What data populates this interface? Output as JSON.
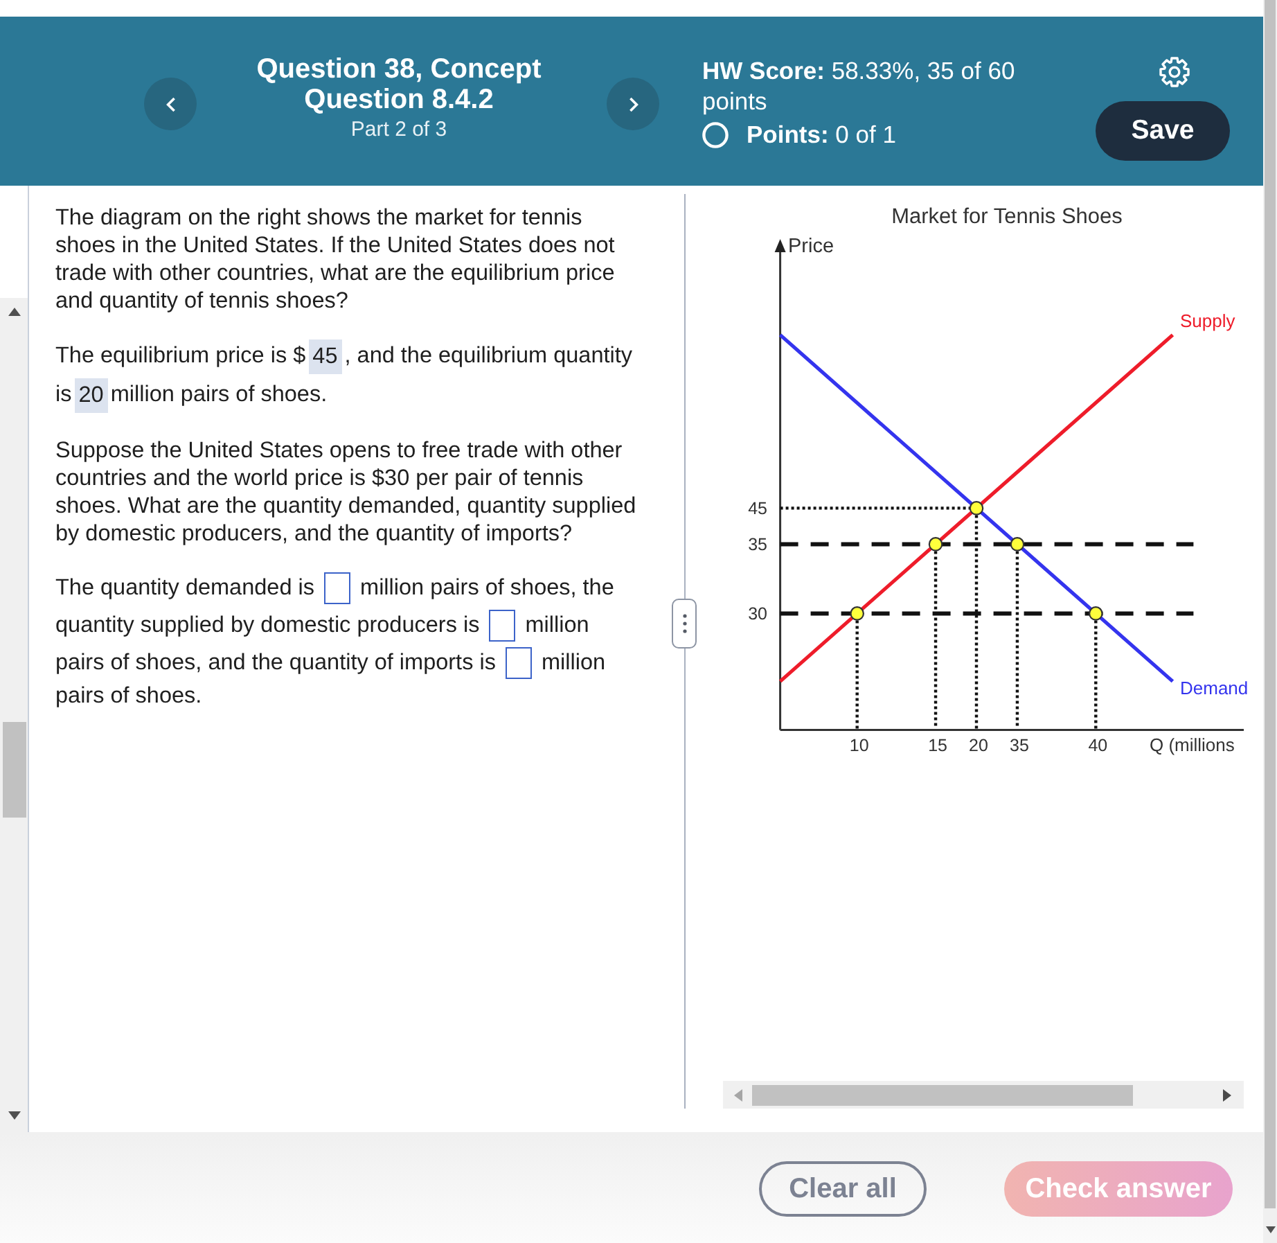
{
  "header": {
    "title": "Question 38, Concept Question 8.4.2",
    "subtitle": "Part 2 of 3",
    "score": "**HW Score:** 58.33%, 35 of 60 points",
    "points": "**Points:** 0 of 1",
    "save_button": "Save"
  },
  "question": {
    "paragraphs": [
      {
        "parts": [
          {
            "kind": "text",
            "text": "The diagram on the right shows the market for tennis shoes in the United States. If the United States does not trade with other countries, what are the equilibrium price and quantity of tennis shoes?"
          }
        ]
      },
      {
        "parts": [
          {
            "kind": "text",
            "text": "The equilibrium price is $"
          },
          {
            "kind": "answer",
            "value": "45"
          },
          {
            "kind": "text",
            "text": ", and the equilibrium quantity is"
          },
          {
            "kind": "answer",
            "value": "20"
          },
          {
            "kind": "text",
            "text": "million pairs of shoes."
          }
        ]
      },
      {
        "parts": [
          {
            "kind": "text",
            "text": "Suppose the United States opens to free trade with other countries and the world price is $30 per pair of tennis shoes. What are the quantity demanded, quantity supplied by domestic producers, and the quantity of imports?"
          }
        ]
      },
      {
        "parts": [
          {
            "kind": "text",
            "text": "The quantity demanded is"
          },
          {
            "kind": "answer"
          },
          {
            "kind": "text",
            "text": "million pairs of shoes, the quantity supplied by domestic producers is"
          },
          {
            "kind": "answer"
          },
          {
            "kind": "text",
            "text": "million pairs of shoes, and the quantity of imports is"
          },
          {
            "kind": "answer"
          },
          {
            "kind": "text",
            "text": "million pairs of shoes."
          }
        ]
      }
    ]
  },
  "graph": {
    "title": "Market for Tennis Shoes",
    "y_axis_label": "Price",
    "x_axis_label": "Q (millions",
    "curves": [
      {
        "kind": "supply",
        "label": "Supply",
        "color": "#ee1c2a"
      },
      {
        "kind": "demand",
        "label": "Demand",
        "color": "#3434ee"
      }
    ],
    "price_levels": [
      {
        "label": "45",
        "kind": "dotted"
      },
      {
        "label": "35",
        "kind": "dashed"
      },
      {
        "label": "30",
        "kind": "dashed"
      }
    ],
    "quantity_ticks": [
      "10",
      "15",
      "20",
      "35",
      "40"
    ]
  },
  "buttons": [
    {
      "kind": "outline",
      "label": "Clear all",
      "disabled": false
    },
    {
      "kind": "primary",
      "label": "Check answer",
      "disabled": true
    }
  ]
}
